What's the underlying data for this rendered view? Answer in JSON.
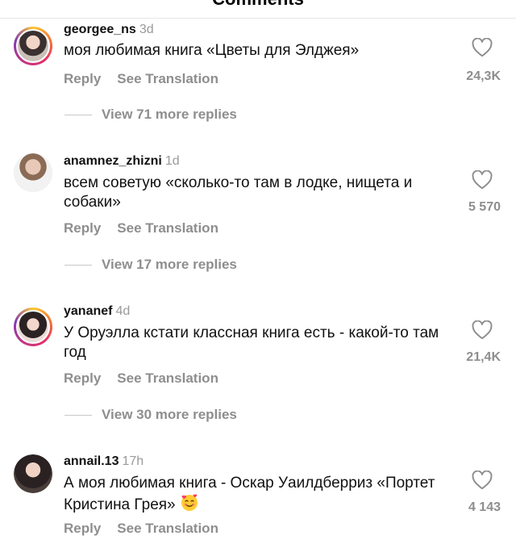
{
  "header": {
    "title": "Comments"
  },
  "comments": [
    {
      "username": "georgee_ns",
      "time": "3d",
      "text": "моя любимая книга «Цветы для Элджея»",
      "reply_label": "Reply",
      "translate_label": "See Translation",
      "likes": "24,3K",
      "view_replies": "View 71 more replies",
      "avatar_ring": true
    },
    {
      "username": "anamnez_zhizni",
      "time": "1d",
      "text": "всем советую «сколько-то там в лодке, нищета и собаки»",
      "reply_label": "Reply",
      "translate_label": "See Translation",
      "likes": "5 570",
      "view_replies": "View 17 more replies",
      "avatar_ring": false
    },
    {
      "username": "yananef",
      "time": "4d",
      "text": "У Оруэлла кстати классная книга есть - какой-то там год",
      "reply_label": "Reply",
      "translate_label": "See Translation",
      "likes": "21,4K",
      "view_replies": "View 30 more replies",
      "avatar_ring": true
    },
    {
      "username": "annail.13",
      "time": "17h",
      "text": "А моя любимая книга - Оскар Уаилдберриз «Портет Кристина Грея»",
      "emoji": "smiling-face-with-hearts-emoji",
      "reply_label": "Reply",
      "translate_label": "See Translation",
      "likes": "4 143",
      "avatar_ring": false
    }
  ],
  "colors": {
    "secondary_text": "#8e8e8e",
    "primary_text": "#111111",
    "story_ring": "#e1306c"
  }
}
